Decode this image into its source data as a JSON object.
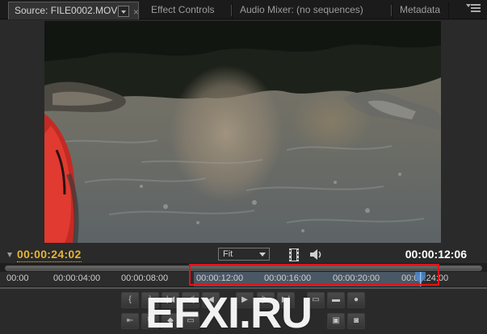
{
  "tabs": [
    {
      "label": "Source: FILE0002.MOV",
      "active": true
    },
    {
      "label": "Effect Controls",
      "active": false
    },
    {
      "label": "Audio Mixer: (no sequences)",
      "active": false
    },
    {
      "label": "Metadata",
      "active": false
    }
  ],
  "timecode_current": "00:00:24:02",
  "timecode_duration": "00:00:12:06",
  "zoom_select": {
    "value": "Fit"
  },
  "ruler": {
    "labels": [
      "00:00",
      "00:00:04:00",
      "00:00:08:00",
      "00:00:12:00",
      "00:00:16:00",
      "00:00:20:00",
      "00:00:24:00"
    ]
  },
  "watermark": "EFXI.RU",
  "colors": {
    "timecode_current": "#e8b430",
    "highlight_box": "#e1141a",
    "playhead": "#4a86c8"
  }
}
